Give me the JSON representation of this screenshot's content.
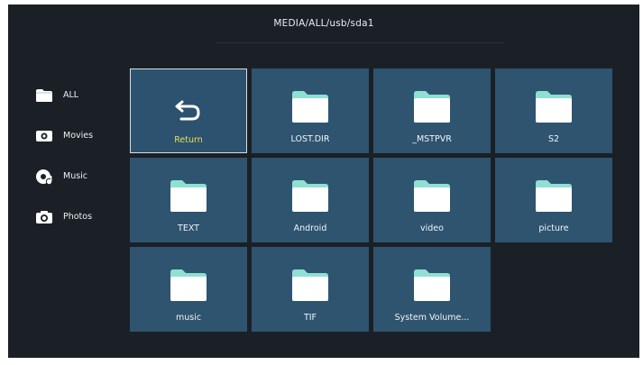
{
  "path": "MEDIA/ALL/usb/sda1",
  "sidebar": {
    "items": [
      {
        "label": "ALL",
        "icon": "folder-icon"
      },
      {
        "label": "Movies",
        "icon": "movie-icon"
      },
      {
        "label": "Music",
        "icon": "music-icon"
      },
      {
        "label": "Photos",
        "icon": "camera-icon"
      }
    ]
  },
  "grid": {
    "tiles": [
      {
        "label": "Return",
        "icon": "return-icon",
        "selected": true
      },
      {
        "label": "LOST.DIR",
        "icon": "folder-icon"
      },
      {
        "label": "_MSTPVR",
        "icon": "folder-icon"
      },
      {
        "label": "S2",
        "icon": "folder-icon"
      },
      {
        "label": "TEXT",
        "icon": "folder-icon"
      },
      {
        "label": "Android",
        "icon": "folder-icon"
      },
      {
        "label": "video",
        "icon": "folder-icon"
      },
      {
        "label": "picture",
        "icon": "folder-icon"
      },
      {
        "label": "music",
        "icon": "folder-icon"
      },
      {
        "label": "TIF",
        "icon": "folder-icon"
      },
      {
        "label": "System Volume...",
        "icon": "folder-icon"
      }
    ]
  },
  "colors": {
    "background": "#1b2026",
    "tile": "#2e5470",
    "selected_label": "#e8df55",
    "folder_tab": "#8fe0d2",
    "folder_body": "#ffffff"
  }
}
